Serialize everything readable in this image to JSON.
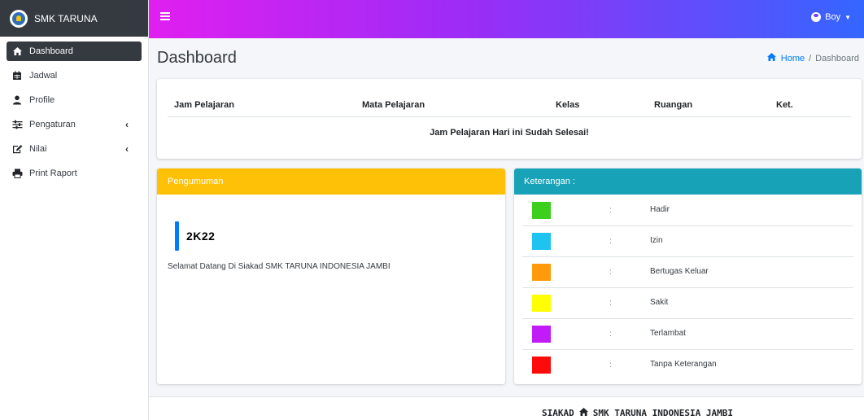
{
  "app": {
    "brand": "SMK TARUNA"
  },
  "sidebar": {
    "items": [
      {
        "label": "Dashboard",
        "icon": "home-icon"
      },
      {
        "label": "Jadwal",
        "icon": "calendar-icon"
      },
      {
        "label": "Profile",
        "icon": "user-icon"
      },
      {
        "label": "Pengaturan",
        "icon": "sliders-icon"
      },
      {
        "label": "Nilai",
        "icon": "edit-icon"
      },
      {
        "label": "Print Raport",
        "icon": "print-icon"
      }
    ]
  },
  "topbar": {
    "user_name": "Boy"
  },
  "header": {
    "title": "Dashboard",
    "breadcrumb_home": "Home",
    "breadcrumb_sep": "/",
    "breadcrumb_current": "Dashboard"
  },
  "schedule": {
    "columns": [
      "Jam Pelajaran",
      "Mata Pelajaran",
      "Kelas",
      "Ruangan",
      "Ket."
    ],
    "empty_message": "Jam Pelajaran Hari ini Sudah Selesai!"
  },
  "announcement": {
    "header": "Pengumuman",
    "title": "2K22",
    "text": "Selamat Datang Di Siakad SMK TARUNA INDONESIA JAMBI"
  },
  "legend": {
    "header": "Keterangan :",
    "colon": ":",
    "items": [
      {
        "label": "Hadir",
        "color": "#3ccf1e"
      },
      {
        "label": "Izin",
        "color": "#1ec3f0"
      },
      {
        "label": "Bertugas Keluar",
        "color": "#ff9a0a"
      },
      {
        "label": "Sakit",
        "color": "#ffff00"
      },
      {
        "label": "Terlambat",
        "color": "#c21bf7"
      },
      {
        "label": "Tanpa Keterangan",
        "color": "#ff0a0a"
      }
    ]
  },
  "footer": {
    "left": "SIAKAD",
    "right": "SMK TARUNA INDONESIA JAMBI"
  },
  "colors": {
    "sidebar_active": "#343a40",
    "announcement_header": "#ffc107",
    "legend_header": "#17a2b8",
    "accent_blue": "#007bff"
  }
}
